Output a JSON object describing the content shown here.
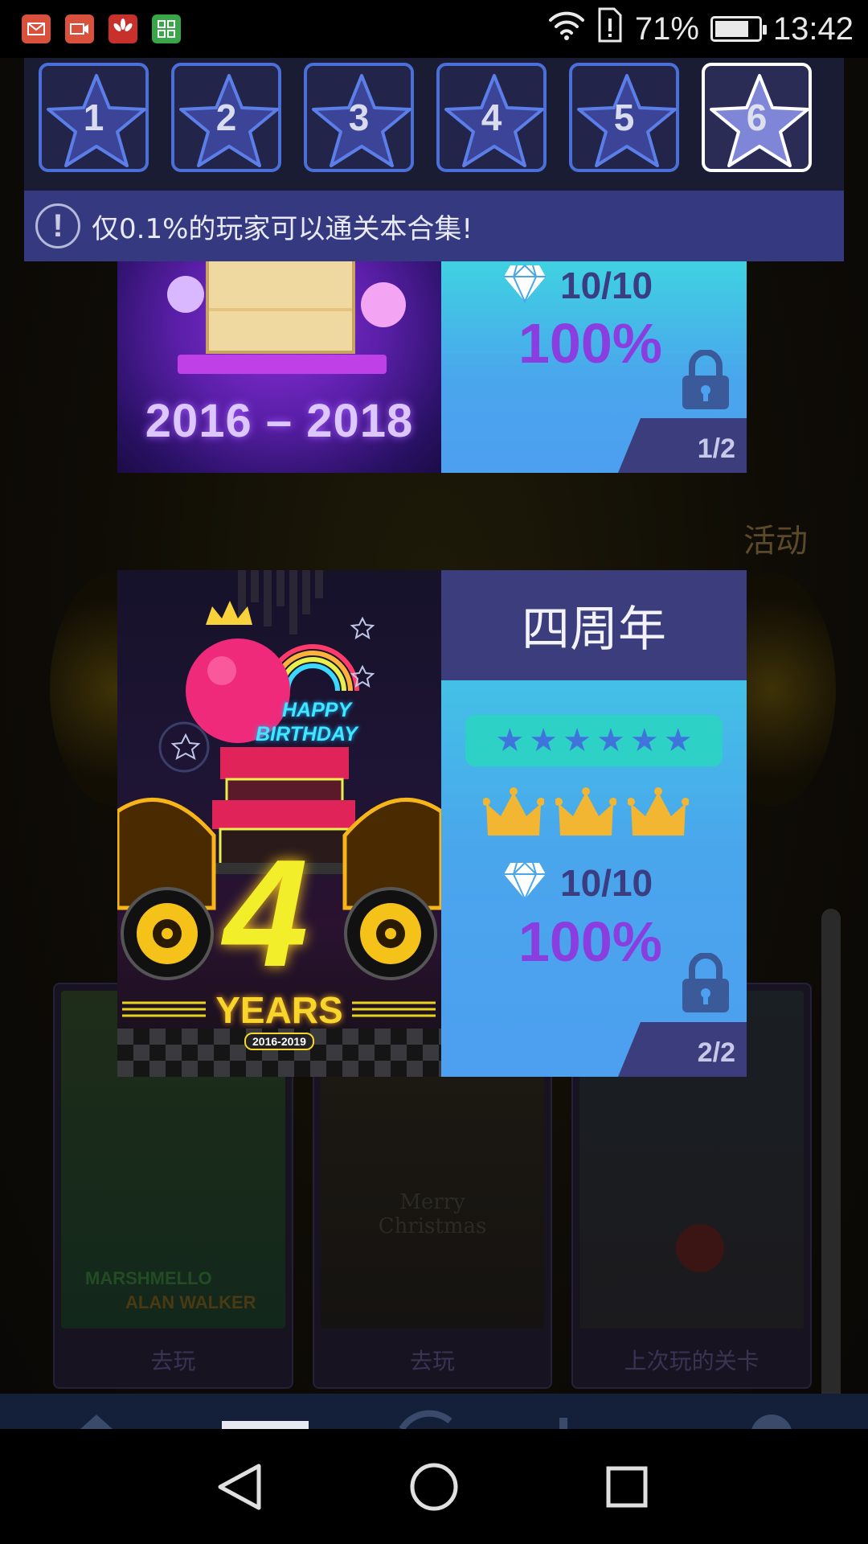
{
  "status_bar": {
    "battery_percent": "71%",
    "battery_level": 0.71,
    "time": "13:42",
    "icons": [
      "mail-app-icon",
      "video-app-icon",
      "huawei-app-icon",
      "apps-icon",
      "wifi-icon",
      "sim-alert-icon",
      "battery-icon"
    ]
  },
  "star_tabs": [
    "1",
    "2",
    "3",
    "4",
    "5",
    "6"
  ],
  "active_tab": "6",
  "notice": {
    "text": "仅0.1%的玩家可以通关本合集!"
  },
  "cards": [
    {
      "image_caption": "2016 – 2018",
      "diamonds": "10/10",
      "percent": "100%",
      "page": "1/2",
      "locked": true
    },
    {
      "title": "四周年",
      "image_caption": "YEARS",
      "image_sub": "2016-2019",
      "image_big": "4",
      "image_banner": [
        "HAPPY",
        "BIRTHDAY"
      ],
      "stars": 6,
      "crowns": 3,
      "diamonds": "10/10",
      "percent": "100%",
      "page": "2/2",
      "locked": true
    }
  ],
  "background": {
    "side_label": "活动",
    "cards": [
      {
        "label": "去玩",
        "art_text": [
          "MARSHMELLO",
          "ALAN WALKER"
        ]
      },
      {
        "label": "去玩",
        "art_text": [
          "Merry",
          "Christmas"
        ]
      },
      {
        "label": "上次玩的关卡",
        "art_text": []
      }
    ]
  },
  "colors": {
    "tab_border": "#4a6fd8",
    "tab_active_border": "#ffffff",
    "card_info_gradient": [
      "#3fd2e2",
      "#4d9ff0"
    ],
    "percent": "#8b3ee0",
    "crown": "#f2b632"
  },
  "nav_bar": [
    "back-icon",
    "home-icon",
    "recents-icon"
  ]
}
